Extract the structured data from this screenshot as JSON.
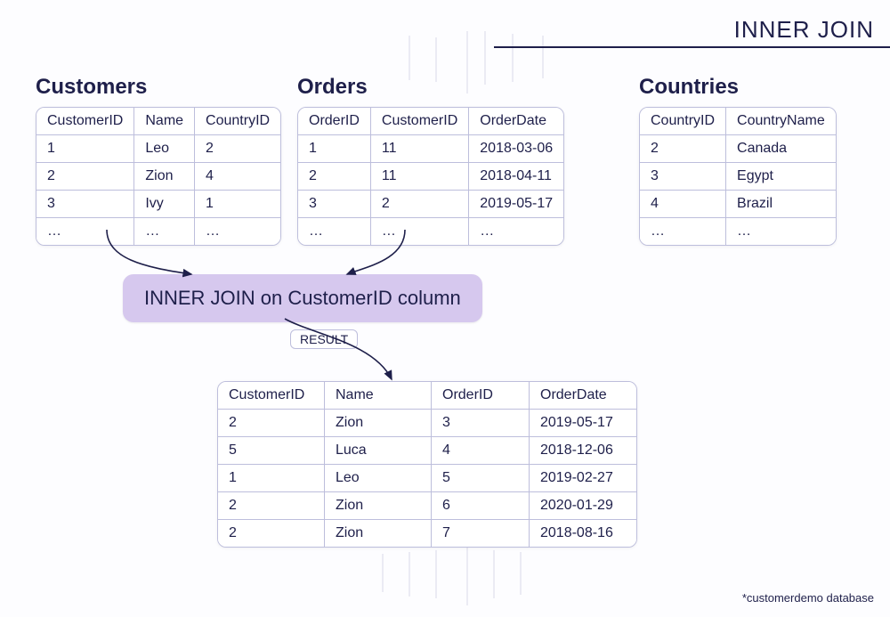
{
  "title": "INNER JOIN",
  "footnote": "*customerdemo database",
  "join_label": "INNER JOIN on CustomerID column",
  "result_label": "RESULT",
  "tables": {
    "customers": {
      "name": "Customers",
      "columns": [
        "CustomerID",
        "Name",
        "CountryID"
      ],
      "rows": [
        [
          "1",
          "Leo",
          "2"
        ],
        [
          "2",
          "Zion",
          "4"
        ],
        [
          "3",
          "Ivy",
          "1"
        ],
        [
          "…",
          "…",
          "…"
        ]
      ]
    },
    "orders": {
      "name": "Orders",
      "columns": [
        "OrderID",
        "CustomerID",
        "OrderDate"
      ],
      "rows": [
        [
          "1",
          "11",
          "2018-03-06"
        ],
        [
          "2",
          "11",
          "2018-04-11"
        ],
        [
          "3",
          "2",
          "2019-05-17"
        ],
        [
          "…",
          "…",
          "…"
        ]
      ]
    },
    "countries": {
      "name": "Countries",
      "columns": [
        "CountryID",
        "CountryName"
      ],
      "rows": [
        [
          "2",
          "Canada"
        ],
        [
          "3",
          "Egypt"
        ],
        [
          "4",
          "Brazil"
        ],
        [
          "…",
          "…"
        ]
      ]
    },
    "result": {
      "columns": [
        "CustomerID",
        "Name",
        "OrderID",
        "OrderDate"
      ],
      "rows": [
        [
          "2",
          "Zion",
          "3",
          "2019-05-17"
        ],
        [
          "5",
          "Luca",
          "4",
          "2018-12-06"
        ],
        [
          "1",
          "Leo",
          "5",
          "2019-02-27"
        ],
        [
          "2",
          "Zion",
          "6",
          "2020-01-29"
        ],
        [
          "2",
          "Zion",
          "7",
          "2018-08-16"
        ]
      ]
    }
  }
}
